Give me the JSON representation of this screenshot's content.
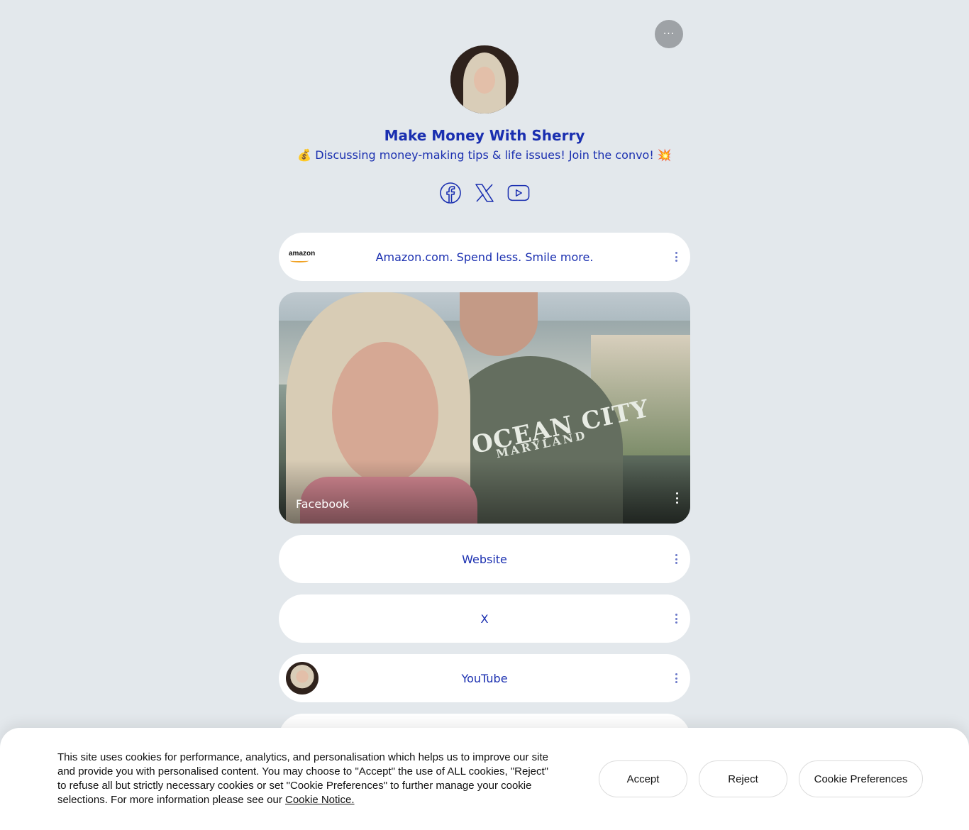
{
  "header": {
    "more_label": "···",
    "title": "Make Money With Sherry",
    "bio": "💰 Discussing money-making tips & life issues! Join the convo! 💥"
  },
  "socials": [
    {
      "icon": "facebook-icon"
    },
    {
      "icon": "x-icon"
    },
    {
      "icon": "youtube-icon"
    }
  ],
  "links": [
    {
      "label": "Amazon.com. Spend less. Smile more.",
      "thumb": "amazon"
    },
    {
      "label": "Facebook",
      "thumb": "photo"
    },
    {
      "label": "Website"
    },
    {
      "label": "X"
    },
    {
      "label": "YouTube",
      "thumb": "avatar"
    }
  ],
  "amazon_logo_text": "amazon",
  "photo": {
    "shirt_line1": "OCEAN CITY",
    "shirt_line2": "MARYLAND"
  },
  "cookie": {
    "text": "This site uses cookies for performance, analytics, and personalisation which helps us to improve our site and provide you with personalised content. You may choose to \"Accept\" the use of ALL cookies, \"Reject\" to refuse all but strictly necessary cookies or set \"Cookie Preferences\" to further manage your cookie selections. For more information please see our ",
    "link": "Cookie Notice.",
    "accept": "Accept",
    "reject": "Reject",
    "preferences": "Cookie Preferences"
  },
  "colors": {
    "background": "#e3e8ec",
    "accent": "#1a2fb0",
    "card": "#ffffff"
  }
}
